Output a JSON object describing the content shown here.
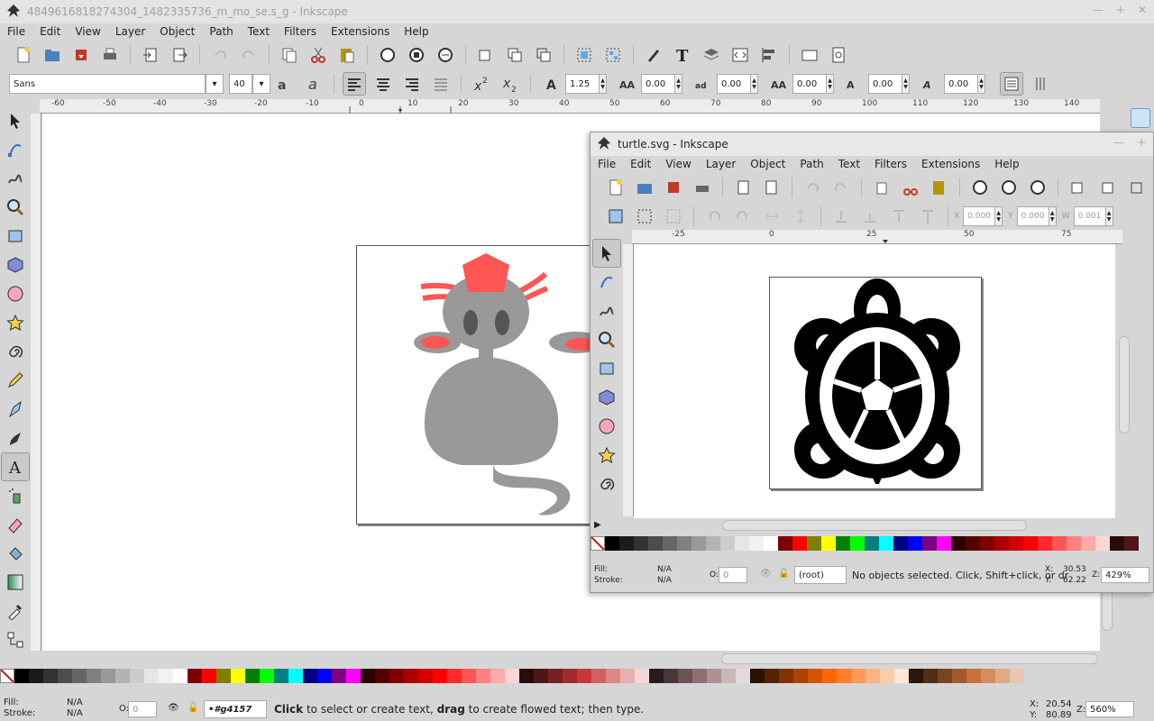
{
  "main": {
    "title": "4849616818274304_1482335736_m_mo_se.s_g - Inkscape",
    "menu": [
      "File",
      "Edit",
      "View",
      "Layer",
      "Object",
      "Path",
      "Text",
      "Filters",
      "Extensions",
      "Help"
    ],
    "text_toolbar": {
      "font_family": "Sans",
      "font_size": "40",
      "line_spacing": "1.25",
      "letter_spacing": "0.00",
      "word_spacing": "0.00",
      "kerning": "0.00",
      "vertical_shift": "0.00",
      "rotation": "0.00"
    },
    "ruler_h": [
      "-60",
      "-50",
      "-40",
      "-30",
      "-20",
      "-10",
      "0",
      "10",
      "20",
      "30",
      "40",
      "50",
      "60",
      "70",
      "80",
      "90",
      "100",
      "110",
      "120",
      "130",
      "140"
    ],
    "status": {
      "fill_label": "Fill:",
      "fill_value": "N/A",
      "stroke_label": "Stroke:",
      "stroke_value": "N/A",
      "opacity_label": "O:",
      "opacity_value": "0",
      "layer": "•#g4157",
      "message_bold1": "Click",
      "message_mid": " to select or create text, ",
      "message_bold2": "drag",
      "message_end": " to create flowed text; then type.",
      "x_label": "X:",
      "x_value": "20.54",
      "y_label": "Y:",
      "y_value": "80.89",
      "z_label": "Z:",
      "zoom": "560%"
    }
  },
  "turtle": {
    "title": "turtle.svg - Inkscape",
    "menu": [
      "File",
      "Edit",
      "View",
      "Layer",
      "Object",
      "Path",
      "Text",
      "Filters",
      "Extensions",
      "Help"
    ],
    "select_toolbar": {
      "x_label": "X",
      "x_value": "0.000",
      "y_label": "Y",
      "y_value": "0.000",
      "w_label": "W",
      "w_value": "0.001"
    },
    "ruler_h": [
      "-25",
      "0",
      "25",
      "50",
      "75"
    ],
    "status": {
      "fill_label": "Fill:",
      "fill_value": "N/A",
      "stroke_label": "Stroke:",
      "stroke_value": "N/A",
      "opacity_label": "O:",
      "opacity_value": "0",
      "layer": "(root)",
      "message": "No objects selected. Click, Shift+click, or dr",
      "x_label": "X:",
      "x_value": "30.53",
      "y_label": "Y:",
      "y_value": "62.22",
      "z_label": "Z:",
      "zoom": "429%"
    }
  },
  "colors": {
    "mouse_gray": "#999999",
    "mouse_pink": "#ff5555",
    "turtle_black": "#000000"
  }
}
